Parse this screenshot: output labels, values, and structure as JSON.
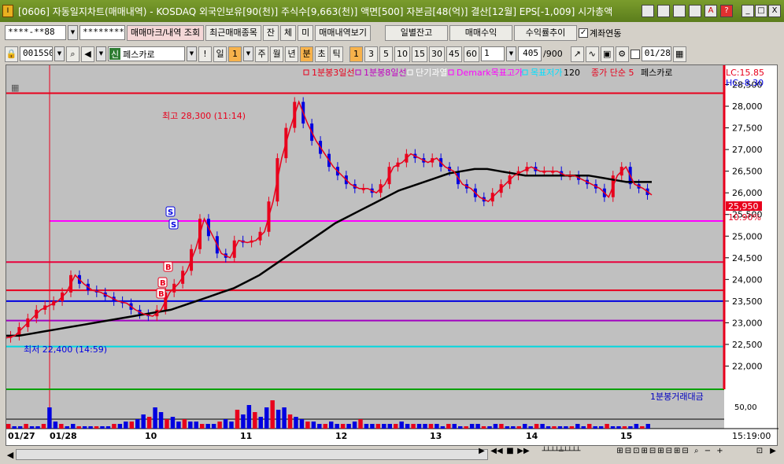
{
  "window": {
    "title": "[0606] 자동일지차트(매매내역) - KOSDAQ 외국인보유[90(천)] 주식수[9,663(천)] 액면[500] 자본금[48(억)] 결산[12월] EPS[-1,009] 시가총액",
    "app_icon": "I",
    "controls": [
      "_",
      "□",
      "X"
    ]
  },
  "toolbar1": {
    "account_value": "****-**88",
    "password_value": "*********",
    "btn_trade_mark": "매매마크/내역 조회",
    "btn_recent": "최근매매종목",
    "btn_balance": "잔",
    "btn_conclude": "체",
    "btn_unconclude": "미",
    "btn_trade_history": "매매내역보기",
    "btn_daily": "일별잔고",
    "btn_profit": "매매수익",
    "btn_return": "수익률추이",
    "chk_account_link": "계좌연동"
  },
  "toolbar2": {
    "code_value": "0015S0",
    "stock_tag": "신",
    "stock_name": "페스카로",
    "periods": [
      "일",
      "1",
      "주",
      "월",
      "년",
      "분",
      "초",
      "틱"
    ],
    "active_unit": "분",
    "minutes": [
      "1",
      "3",
      "5",
      "10",
      "15",
      "30",
      "45",
      "60"
    ],
    "active_minute": "1",
    "count_value": "1",
    "range_value": "405",
    "range_total": "/900",
    "date_value": "01/28"
  },
  "chart_data": {
    "type": "line",
    "legend": [
      {
        "name": "1분봉3일선",
        "color": "#e8001c"
      },
      {
        "name": "1분봉8일선",
        "color": "#c000c0"
      },
      {
        "name": "단기과열",
        "color": "#ffffff"
      },
      {
        "name": "Demark목표고가",
        "color": "#ff00ff"
      },
      {
        "name": "목표저가",
        "color": "#00e0ff"
      },
      {
        "name": "120",
        "color": "#000000"
      },
      {
        "name": "종가 단순 5",
        "color": "#e8001c"
      },
      {
        "name": "페스카로",
        "color": "#000000"
      }
    ],
    "lc_label": "LC:15.85",
    "hc_label": "HC:-8.30",
    "y_ticks": [
      "28,500",
      "28,000",
      "27,500",
      "27,000",
      "26,500",
      "26,000",
      "25,500",
      "25,000",
      "24,500",
      "24,000",
      "23,500",
      "23,000",
      "22,500",
      "22,000"
    ],
    "ylim": [
      21500,
      28800
    ],
    "price_label": "25,950",
    "pct_label": "10.90%",
    "high_annotation": "최고 28,300 (11:14)",
    "low_annotation": "최저 22,400 (14:59)",
    "hlines": [
      {
        "value": 28300,
        "color": "#e8001c"
      },
      {
        "value": 25350,
        "color": "#ff00ff"
      },
      {
        "value": 24400,
        "color": "#e8003c"
      },
      {
        "value": 23750,
        "color": "#e8001c"
      },
      {
        "value": 23500,
        "color": "#0000e0"
      },
      {
        "value": 23050,
        "color": "#a000c0"
      },
      {
        "value": 22450,
        "color": "#00d8e0"
      }
    ],
    "x_labels": [
      "01/27",
      "01/28",
      "10",
      "11",
      "12",
      "13",
      "14",
      "15"
    ],
    "time_label": "15:19:00",
    "close_series": [
      22650,
      22700,
      22900,
      23100,
      23300,
      23400,
      23500,
      23700,
      24100,
      23900,
      23750,
      23700,
      23600,
      23500,
      23450,
      23300,
      23200,
      23150,
      23300,
      23700,
      23900,
      24200,
      24700,
      25400,
      25000,
      24600,
      24500,
      24900,
      24850,
      24900,
      25100,
      25800,
      26800,
      27500,
      28100,
      27600,
      27200,
      26900,
      26600,
      26400,
      26200,
      26100,
      26100,
      26000,
      26200,
      26600,
      26700,
      26900,
      26800,
      26700,
      26800,
      26600,
      26500,
      26200,
      26100,
      25900,
      25800,
      26000,
      26200,
      26400,
      26500,
      26600,
      26500,
      26500,
      26500,
      26400,
      26400,
      26300,
      26200,
      26100,
      25900,
      26400,
      26600,
      26200,
      26100,
      25950
    ],
    "ma120_series": [
      22700,
      22700,
      22750,
      22800,
      22850,
      22900,
      22950,
      23000,
      23050,
      23100,
      23150,
      23200,
      23250,
      23300,
      23400,
      23500,
      23600,
      23700,
      23800,
      23950,
      24100,
      24300,
      24500,
      24700,
      24900,
      25100,
      25300,
      25450,
      25600,
      25750,
      25900,
      26050,
      26150,
      26250,
      26350,
      26450,
      26500,
      26550,
      26550,
      26500,
      26450,
      26400,
      26400,
      26400,
      26400,
      26400,
      26400,
      26350,
      26300,
      26250,
      26250,
      26250
    ],
    "signals": [
      {
        "type": "S",
        "label": "S"
      },
      {
        "type": "S",
        "label": "S"
      },
      {
        "type": "B",
        "label": "B"
      },
      {
        "type": "B",
        "label": "B"
      },
      {
        "type": "B",
        "label": "B"
      }
    ],
    "volume_legend": "1분봉거래대금",
    "volume_tick": "50,00",
    "volume_bars": [
      2,
      1,
      1,
      2,
      1,
      1,
      2,
      9,
      3,
      2,
      1,
      2,
      1,
      1,
      1,
      1,
      1,
      1,
      2,
      2,
      3,
      3,
      4,
      6,
      5,
      9,
      7,
      4,
      5,
      3,
      4,
      3,
      3,
      2,
      2,
      2,
      3,
      4,
      3,
      8,
      6,
      10,
      7,
      5,
      9,
      12,
      8,
      9,
      6,
      5,
      4,
      3,
      3,
      2,
      2,
      3,
      2,
      2,
      2,
      3,
      4,
      2,
      2,
      2,
      2,
      2,
      2,
      3,
      2,
      2,
      2,
      2,
      2,
      2,
      1,
      2,
      2,
      1,
      1,
      2,
      2,
      1,
      1,
      2,
      2,
      1,
      1,
      1,
      2,
      1,
      2,
      2,
      1,
      1,
      1,
      1,
      1,
      2,
      1,
      2,
      1,
      1,
      2,
      1,
      1,
      1,
      1,
      2,
      1,
      2
    ]
  },
  "statusbar": {
    "controls": [
      "▶",
      "◀◀",
      "■",
      "▶▶"
    ]
  }
}
